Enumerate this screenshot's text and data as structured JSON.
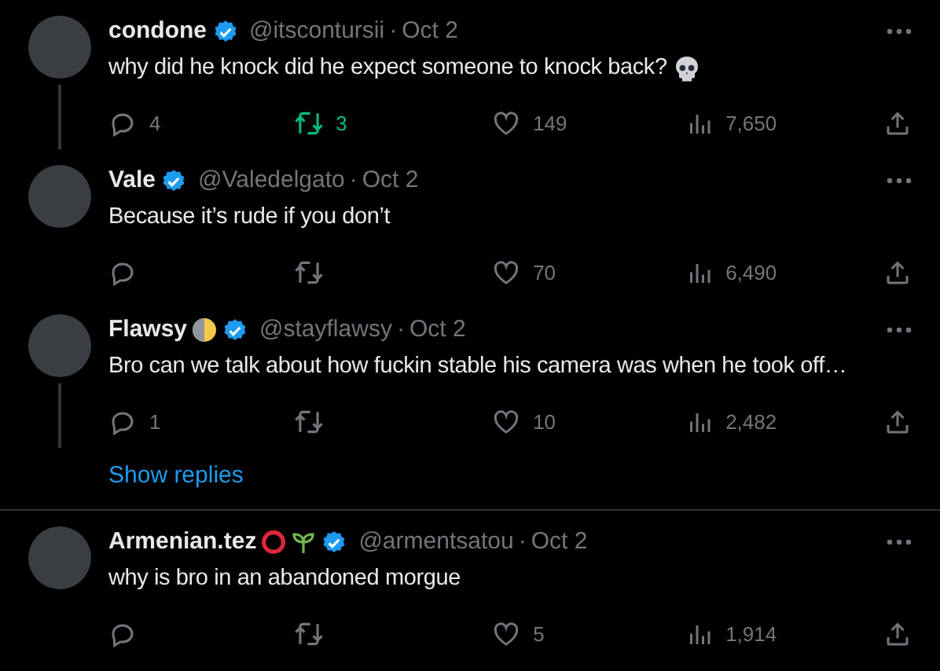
{
  "tweets": [
    {
      "name": "condone",
      "handle": "@itscontursii",
      "separator": "·",
      "date": "Oct 2",
      "text": "why did he knock did he expect someone to knock back?",
      "text_emojis": [
        {
          "kind": "skull"
        }
      ],
      "thread_line": true,
      "replies": "4",
      "retweets": "3",
      "retweeted": true,
      "likes": "149",
      "views": "7,650"
    },
    {
      "name": "Vale",
      "handle": "@Valedelgato",
      "separator": "·",
      "date": "Oct 2",
      "text": "Because it’s rude if you don’t",
      "thread_line": false,
      "retweeted": false,
      "likes": "70",
      "views": "6,490"
    },
    {
      "name": "Flawsy",
      "name_emojis": [
        {
          "kind": "half-moon"
        }
      ],
      "handle": "@stayflawsy",
      "separator": "·",
      "date": "Oct 2",
      "text": "Bro can we talk about how fuckin stable his camera was when he took off…",
      "thread_line": true,
      "replies": "1",
      "retweeted": false,
      "likes": "10",
      "views": "2,482",
      "show_replies": "Show replies"
    },
    {
      "name": "Armenian.tez",
      "name_emojis": [
        {
          "kind": "ring"
        },
        {
          "kind": "seedling"
        }
      ],
      "handle": "@armentsatou",
      "separator": "·",
      "date": "Oct 2",
      "text": "why is bro in an abandoned morgue",
      "thread_line": false,
      "retweeted": false,
      "likes": "5",
      "views": "1,914"
    }
  ]
}
